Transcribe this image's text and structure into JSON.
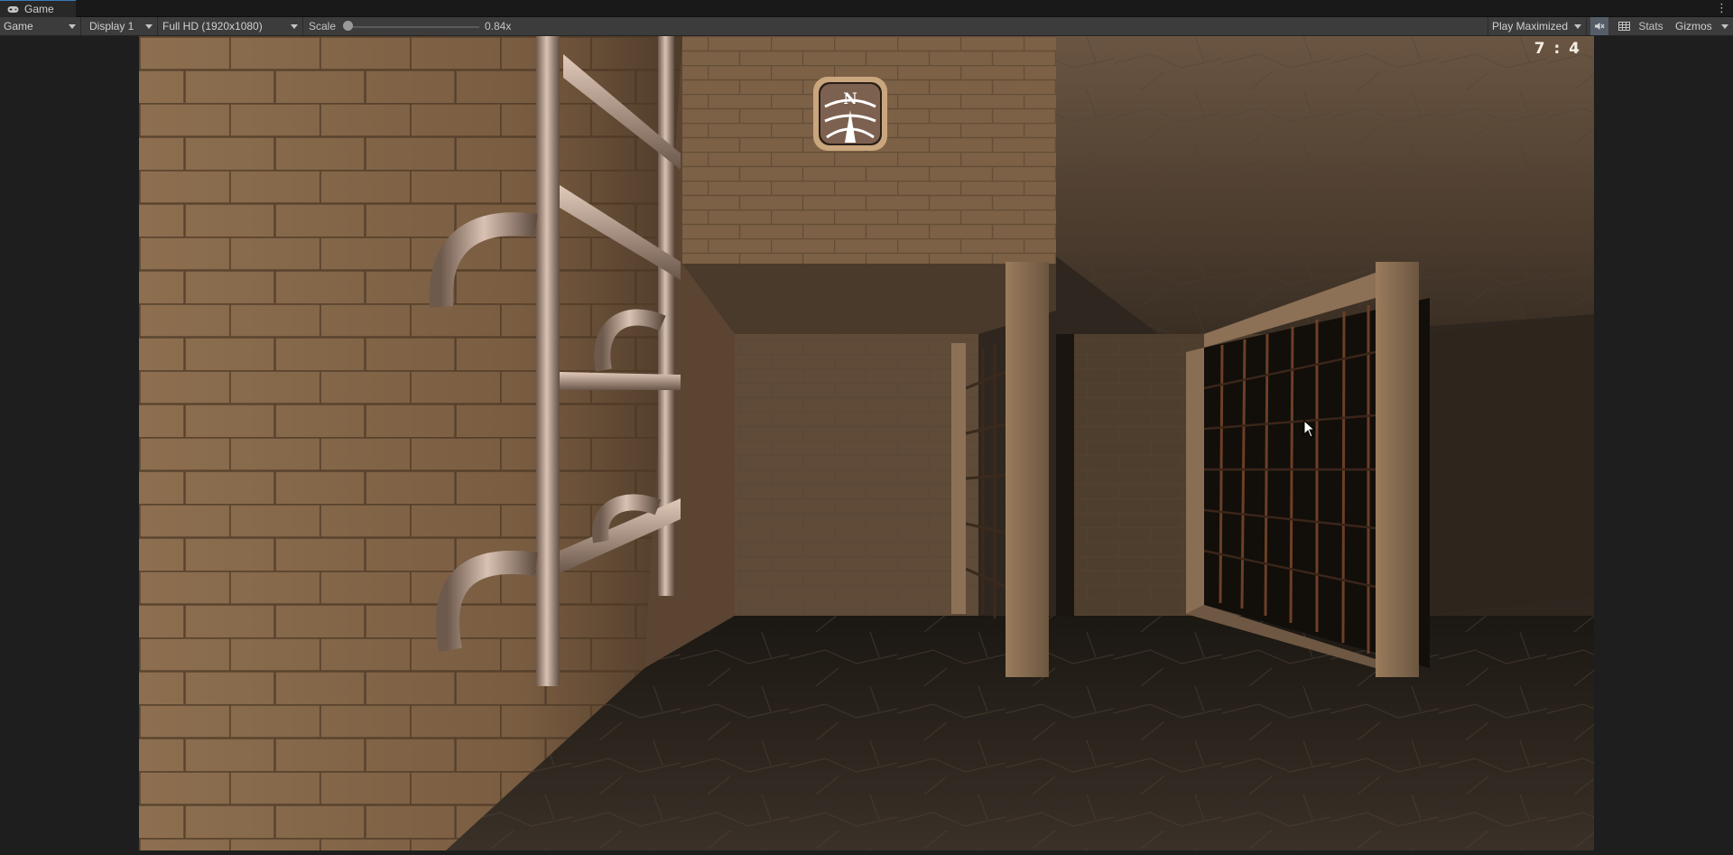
{
  "window": {
    "tab_title": "Game",
    "menu_glyph": "⋮"
  },
  "toolbar": {
    "display_mode": "Game",
    "display": "Display 1",
    "resolution": "Full HD (1920x1080)",
    "scale_label": "Scale",
    "scale_value": "0.84x",
    "scale_level": 0.0,
    "play_mode": "Play Maximized",
    "mute_icon": "audio-mute-icon",
    "stats_icon": "stats-grid-icon",
    "stats_label": "Stats",
    "gizmos_label": "Gizmos"
  },
  "game": {
    "timer": "7 : 4",
    "compass_letter": "N",
    "icons": [
      "compass-icon",
      "mouse-cursor-icon",
      "gamepad-icon"
    ],
    "colors": {
      "wall": "#8a6b4c",
      "floor": "#2b251e",
      "ceiling": "#5a4838",
      "hud_text": "#f3efe4",
      "compass_frame": "#c6a27a"
    }
  }
}
